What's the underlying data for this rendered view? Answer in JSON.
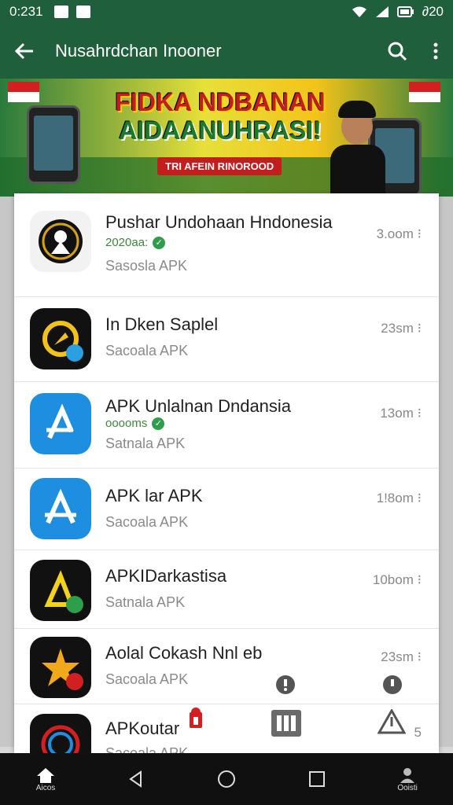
{
  "status_bar": {
    "time": "0:231",
    "battery_text": "∂20"
  },
  "app_bar": {
    "title": "Nusahrdchan Inooner"
  },
  "banner": {
    "headline_line1": "FIDKA NDBANAN",
    "headline_line2": "AIDAANUHRASI!",
    "subline": "TRI AFEIN RINOROOD"
  },
  "apps": [
    {
      "name": "Pushar Undohaan Hndonesia",
      "meta": "2020aa:",
      "verified": true,
      "sub": "Sasosla APK",
      "size": "3.oom ⁝"
    },
    {
      "name": "In Dken Saplel",
      "meta": "",
      "verified": false,
      "sub": "Sacoala APK",
      "size": "23sm ⁝"
    },
    {
      "name": "APK Unlalnan Dndansia",
      "meta": "ooooms",
      "verified": true,
      "sub": "Satnala APK",
      "size": "13om ⁝"
    },
    {
      "name": "APK lar APK",
      "meta": "",
      "verified": false,
      "sub": "Sacoala APK",
      "size": "1!8om ⁝"
    },
    {
      "name": "APKIDarkastisa",
      "meta": "",
      "verified": false,
      "sub": "Satnala APK",
      "size": "10bom ⁝"
    },
    {
      "name": "Aolal Cokash Nnl eb",
      "meta": "",
      "verified": false,
      "sub": "Sacoala APK",
      "size": "23sm ⁝"
    },
    {
      "name": "APKoutar",
      "meta": "",
      "verified": false,
      "sub": "Sacoala APK",
      "size": "5"
    }
  ],
  "bottom_nav": {
    "home_label": "Aicos",
    "profile_label": "Ooisti"
  },
  "colors": {
    "primary": "#1f5f3c",
    "verified": "#2e9d4c"
  }
}
